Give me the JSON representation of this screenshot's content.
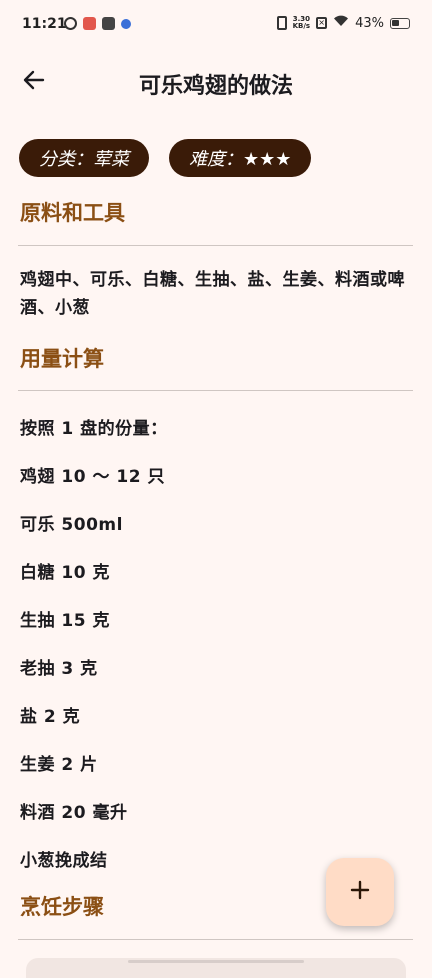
{
  "status_bar": {
    "time": "11:21",
    "net_speed_value": "3.30",
    "net_speed_unit": "KB/s",
    "battery": "43%",
    "icons": [
      "app-icon",
      "app-icon",
      "mail-icon",
      "bluetooth-icon",
      "vibrate-icon",
      "speed-icon",
      "no-sim-icon",
      "wifi-icon",
      "battery-icon"
    ]
  },
  "app_bar": {
    "title": "可乐鸡翅的做法",
    "back_icon": "arrow-left-icon"
  },
  "chips": {
    "category": "分类：荤菜",
    "difficulty": "难度：★★★"
  },
  "sections": {
    "ingredients": {
      "heading": "原料和工具",
      "text": "鸡翅中、可乐、白糖、生抽、盐、生姜、料酒或啤酒、小葱"
    },
    "quantities": {
      "heading": "用量计算",
      "lines": [
        "按照 1 盘的份量：",
        "鸡翅 10 ～ 12 只",
        "可乐 500ml",
        "白糖 10 克",
        "生抽 15 克",
        "老抽 3 克",
        "盐 2 克",
        "生姜 2 片",
        "料酒 20 毫升",
        "小葱挽成结"
      ]
    },
    "steps": {
      "heading": "烹饪步骤"
    }
  },
  "fab": {
    "icon": "plus-icon"
  },
  "colors": {
    "background": "#fff6f3",
    "chip": "#3a1b08",
    "heading": "#8b4f14",
    "fab": "#ffdcc6"
  }
}
